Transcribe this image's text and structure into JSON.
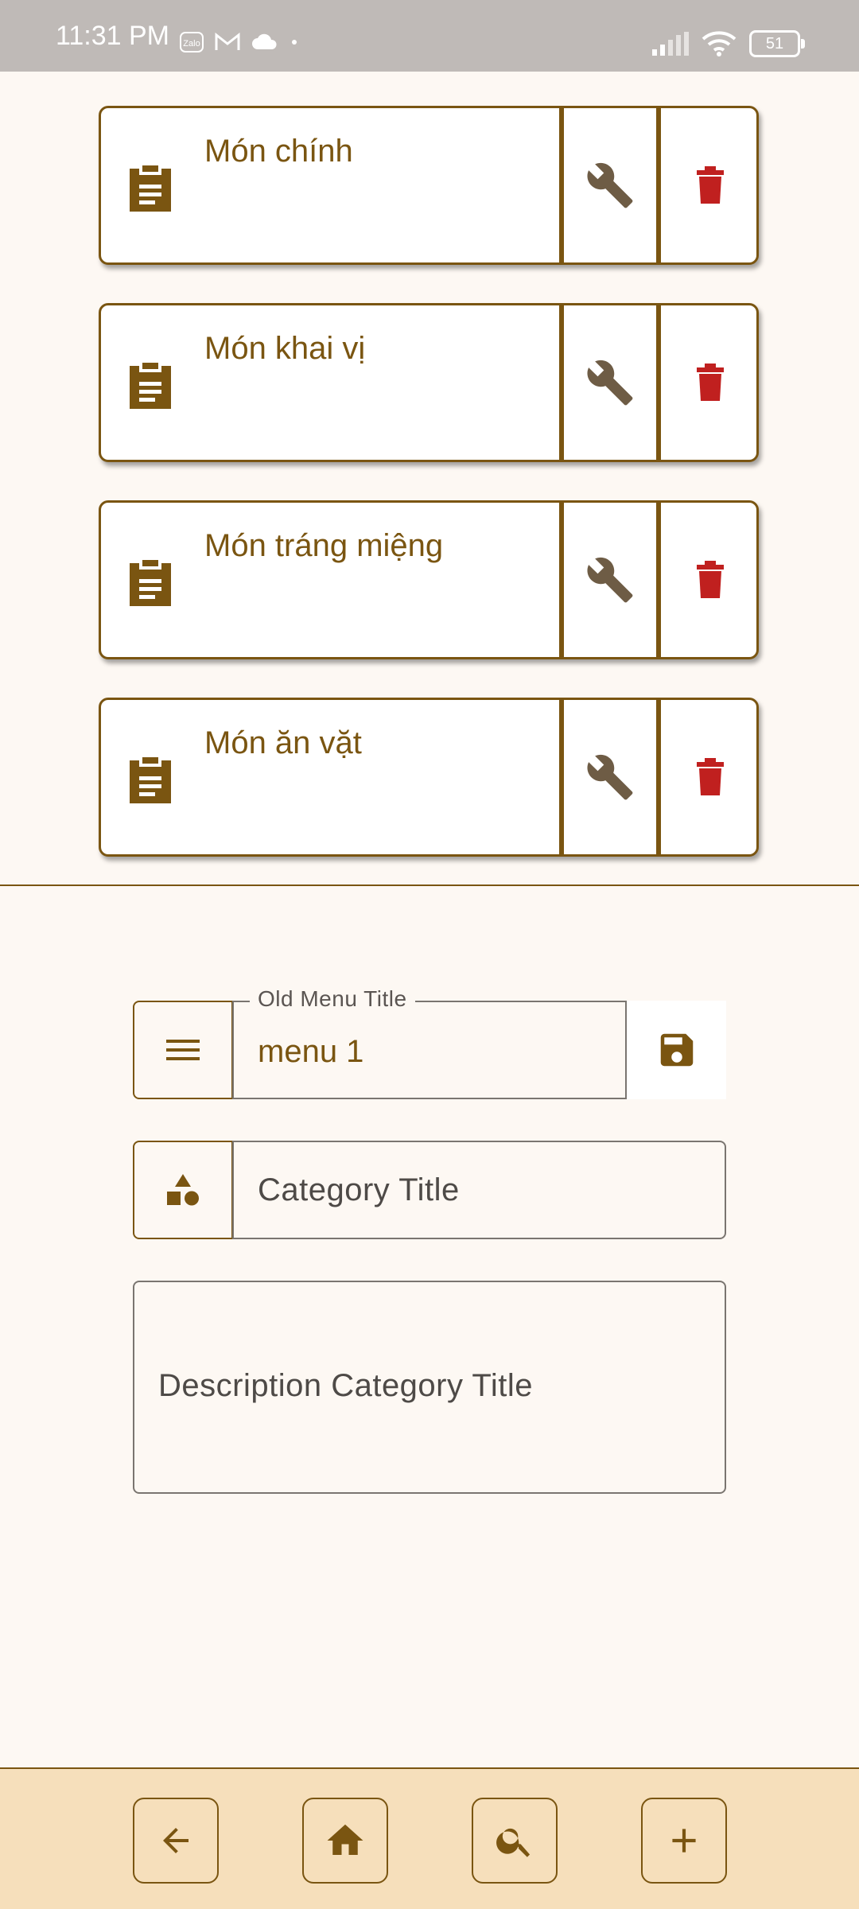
{
  "status_bar": {
    "time": "11:31 PM",
    "notification_icons": [
      "zalo-icon",
      "gmail-icon",
      "cloud-icon",
      "dot-icon"
    ],
    "battery_level": "51",
    "zalo_text": "Zalo"
  },
  "categories": [
    {
      "title": "Món chính"
    },
    {
      "title": "Món khai vị"
    },
    {
      "title": "Món tráng miệng"
    },
    {
      "title": "Món ăn vặt"
    }
  ],
  "form": {
    "menu_title_label": "Old Menu Title",
    "menu_title_value": "menu 1",
    "category_title_placeholder": "Category Title",
    "description_placeholder": "Description Category Title"
  },
  "bottom_nav": {
    "items": [
      "back-arrow-icon",
      "home-icon",
      "search-icon",
      "add-icon"
    ]
  },
  "colors": {
    "brand_brown": "#7a5511",
    "delete_red": "#c0201f",
    "wrench_gray": "#6e5c45",
    "background": "#fdf8f3",
    "bottom_bar": "#f6dfbb",
    "status_bar": "#bfbab7"
  }
}
